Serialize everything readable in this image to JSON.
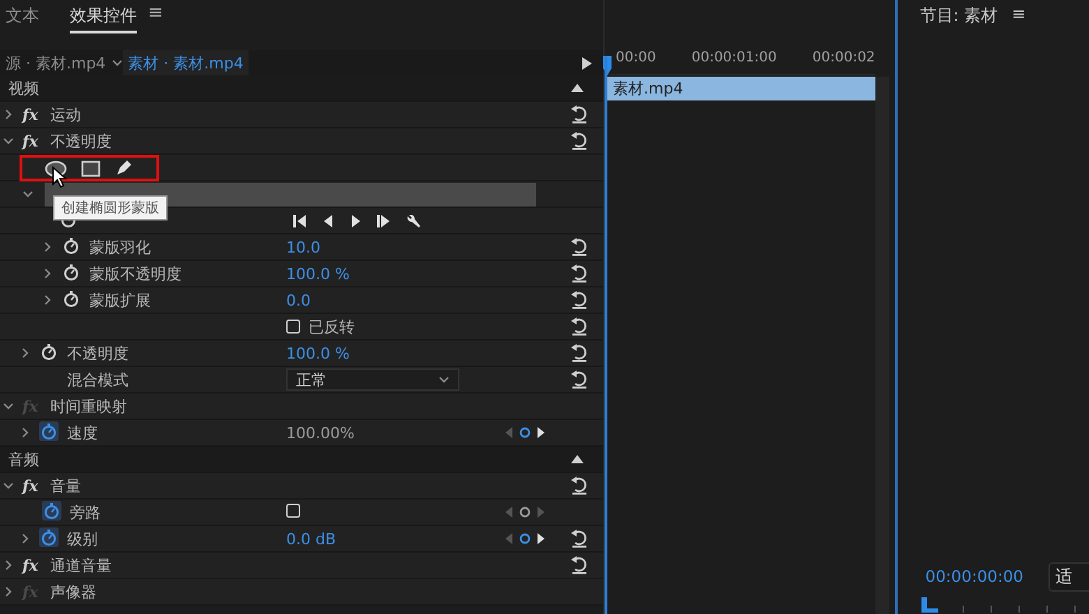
{
  "tabs": [
    {
      "label": "文本",
      "selected": false
    },
    {
      "label": "效果控件",
      "selected": true
    }
  ],
  "panel_menu": "≡",
  "sources": [
    {
      "label": "源 · 素材.mp4",
      "selected": false
    },
    {
      "label": "素材 · 素材.mp4",
      "selected": true
    }
  ],
  "rows": [
    {
      "kind": "section",
      "label": "视频"
    },
    {
      "kind": "effect",
      "label": "运动",
      "fx": "fx",
      "fx_on": true,
      "expanded": false,
      "reset": true
    },
    {
      "kind": "effect",
      "label": "不透明度",
      "fx": "fx",
      "fx_on": true,
      "expanded": true,
      "reset": true
    },
    {
      "kind": "tools"
    },
    {
      "kind": "mask",
      "expanded": true
    },
    {
      "kind": "path",
      "animated": false
    },
    {
      "kind": "maskprop",
      "label": "蒙版羽化",
      "expanded": false,
      "animated": false,
      "value": "10.0",
      "linked": true,
      "reset": true
    },
    {
      "kind": "maskprop",
      "label": "蒙版不透明度",
      "expanded": false,
      "animated": false,
      "value": "100.0 %",
      "linked": true,
      "reset": true
    },
    {
      "kind": "maskprop",
      "label": "蒙版扩展",
      "expanded": false,
      "animated": false,
      "value": "0.0",
      "linked": true,
      "reset": true
    },
    {
      "kind": "check",
      "label": "已反转",
      "checked": false,
      "reset": true
    },
    {
      "kind": "prop",
      "label": "不透明度",
      "expanded": false,
      "animated": false,
      "value": "100.0 %",
      "linked": true,
      "reset": true
    },
    {
      "kind": "select",
      "label": "混合模式",
      "value": "正常",
      "reset": true
    },
    {
      "kind": "effect",
      "label": "时间重映射",
      "fx": "fx",
      "fx_on": false,
      "expanded": true,
      "reset": false
    },
    {
      "kind": "prop",
      "label": "速度",
      "expanded": false,
      "animated": true,
      "value": "100.00%",
      "linked": false,
      "reset": false,
      "nav": true
    },
    {
      "kind": "section",
      "label": "音频"
    },
    {
      "kind": "effect",
      "label": "音量",
      "fx": "fx",
      "fx_on": true,
      "expanded": true,
      "reset": true
    },
    {
      "kind": "checkprop",
      "label": "旁路",
      "animated": true,
      "checked": false,
      "nav": true
    },
    {
      "kind": "prop",
      "label": "级别",
      "expanded": false,
      "animated": true,
      "value": "0.0 dB",
      "linked": true,
      "reset": true,
      "nav": true
    },
    {
      "kind": "effect",
      "label": "通道音量",
      "fx": "fx",
      "fx_on": true,
      "expanded": false,
      "reset": true
    },
    {
      "kind": "effect",
      "label": "声像器",
      "fx": "fx",
      "fx_on": false,
      "expanded": false,
      "reset": false
    }
  ],
  "tooltip": "创建椭圆形蒙版",
  "timeline": {
    "ticks": [
      "00:00",
      "00:00:01:00",
      "00:00:02"
    ],
    "clip": "素材.mp4"
  },
  "program": {
    "title": "节目: 素材",
    "menu": "≡",
    "timecode": "00:00:00:00",
    "fit": "适"
  }
}
